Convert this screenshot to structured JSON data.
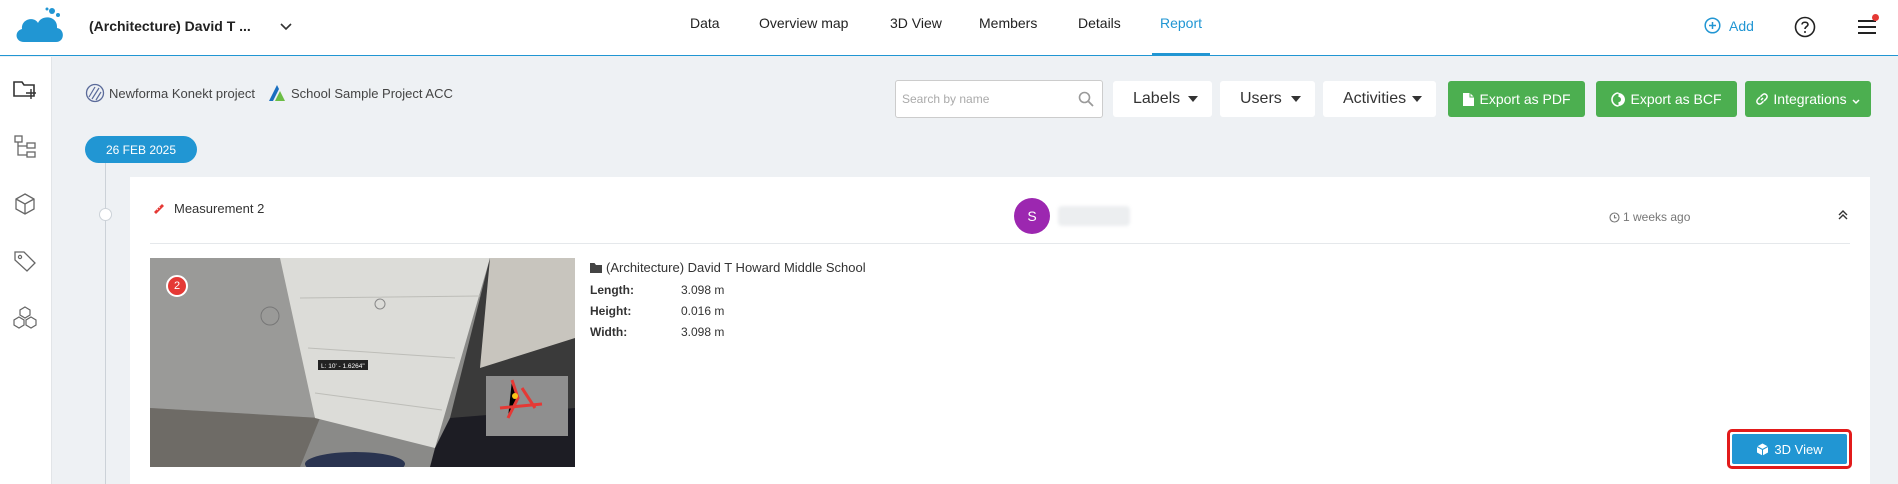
{
  "header": {
    "project_title": "(Architecture) David T ...",
    "tabs": [
      {
        "label": "Data"
      },
      {
        "label": "Overview map"
      },
      {
        "label": "3D View"
      },
      {
        "label": "Members"
      },
      {
        "label": "Details"
      },
      {
        "label": "Report"
      }
    ],
    "active_tab": "Report",
    "add_label": "Add",
    "accent_color": "#2196d3"
  },
  "sidebar": {
    "icons": [
      "folder-tree-icon",
      "hierarchy-icon",
      "cube-icon",
      "tag-icon",
      "cubes-icon"
    ]
  },
  "integrations": [
    {
      "label": "Newforma Konekt project",
      "icon": "newforma-icon"
    },
    {
      "label": "School Sample Project ACC",
      "icon": "autodesk-icon"
    }
  ],
  "filters": {
    "search_placeholder": "Search by name",
    "labels": "Labels",
    "users": "Users",
    "activities": "Activities",
    "export_pdf": "Export as PDF",
    "export_bcf": "Export as BCF",
    "integrations": "Integrations",
    "green": "#4caf50"
  },
  "timeline": {
    "date": "26 FEB 2025"
  },
  "card": {
    "title": "Measurement 2",
    "avatar_letter": "S",
    "avatar_color": "#9c27b0",
    "time_ago": "1 weeks ago",
    "thumbnail_badge": "2",
    "thumbnail_label": "L: 10' - 1.6264\"",
    "folder": "(Architecture) David T Howard Middle School",
    "details": [
      {
        "key": "Length:",
        "value": "3.098 m"
      },
      {
        "key": "Height:",
        "value": "0.016 m"
      },
      {
        "key": "Width:",
        "value": "3.098 m"
      }
    ],
    "view_3d_label": "3D View"
  }
}
